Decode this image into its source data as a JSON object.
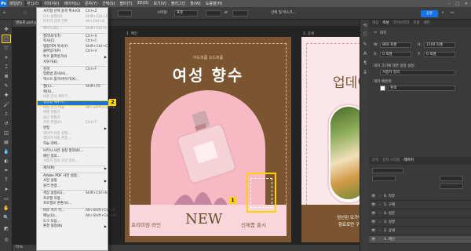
{
  "app": {
    "logo": "Ps",
    "menus": [
      "파일(F)",
      "편집(E)",
      "이미지(I)",
      "레이어(L)",
      "문자(Y)",
      "선택(S)",
      "필터(T)",
      "3D(D)",
      "보기(V)",
      "플러그인",
      "창(W)",
      "도움말(H)"
    ],
    "active_menu_index": 1
  },
  "options_bar": {
    "tolerance_label": "",
    "style_label": "스타일:",
    "style_value": "표준",
    "select_subject": "선택 및 마스크...",
    "share_label": "공유"
  },
  "doc_tab": {
    "title": "댄들로.psd @ 66.7..."
  },
  "canvas": {
    "artboard1_label": "1. 메인",
    "artboard2_label": "2. 상세",
    "artboard1": {
      "subtitle": "아도피룸 오드퍼퓸",
      "title": "여성 향수",
      "bottom_left": "프리미엄 라인",
      "bottom_center": "NEW",
      "bottom_right": "신제품 출시"
    },
    "artboard2": {
      "title": "업데이",
      "line1": "엄선된 오가닉",
      "line2": "향료로만 구성"
    },
    "badge_selection": "1"
  },
  "status_bar": {
    "zoom": "75%"
  },
  "edit_menu": {
    "badge_fill": "2",
    "items": [
      {
        "label": "사각형 선택 윤곽 취소(O)",
        "shortcut": "Ctrl+Z",
        "disabled": false
      },
      {
        "label": "다시 실행(O)",
        "shortcut": "Shift+Ctrl+Z",
        "disabled": true
      },
      {
        "label": "마지막 상태 전환",
        "shortcut": "Alt+Ctrl+Z",
        "disabled": true
      },
      {
        "sep": true
      },
      {
        "label": "페이드(D)...",
        "shortcut": "Shift+Ctrl+F",
        "disabled": true
      },
      {
        "sep": true
      },
      {
        "label": "잘라내기(T)",
        "shortcut": "Ctrl+X",
        "disabled": false
      },
      {
        "label": "복사(C)",
        "shortcut": "Ctrl+C",
        "disabled": false
      },
      {
        "label": "병합하여 복사(Y)",
        "shortcut": "Shift+Ctrl+C",
        "disabled": false
      },
      {
        "label": "붙여넣기(P)",
        "shortcut": "Ctrl+V",
        "disabled": false
      },
      {
        "label": "특수 붙여넣기(I)",
        "shortcut": "",
        "disabled": false,
        "submenu": true
      },
      {
        "label": "지우기(E)",
        "shortcut": "",
        "disabled": false
      },
      {
        "sep": true
      },
      {
        "label": "검색",
        "shortcut": "Ctrl+F",
        "disabled": false
      },
      {
        "label": "맞춤법 검사(H)...",
        "shortcut": "",
        "disabled": false
      },
      {
        "label": "텍스트 찾기/바꾸기(X)...",
        "shortcut": "",
        "disabled": false
      },
      {
        "sep": true
      },
      {
        "label": "칠(L)...",
        "shortcut": "Shift+F5",
        "disabled": false
      },
      {
        "label": "획(S)...",
        "shortcut": "",
        "disabled": false
      },
      {
        "label": "내용 인식 채우기...",
        "shortcut": "",
        "disabled": true
      },
      {
        "label": "생성형 채우기...",
        "shortcut": "",
        "disabled": false,
        "highlighted": true
      },
      {
        "label": "내용 인식 비율",
        "shortcut": "Alt+Shift+Ctrl+C",
        "disabled": true
      },
      {
        "label": "퍼펫 뒤틀기",
        "shortcut": "",
        "disabled": true
      },
      {
        "label": "원근 뒤틀기",
        "shortcut": "",
        "disabled": true
      },
      {
        "label": "자유 변형(F)",
        "shortcut": "Ctrl+T",
        "disabled": true
      },
      {
        "label": "변형",
        "shortcut": "",
        "disabled": false,
        "submenu": true
      },
      {
        "label": "레이어 자동 정렬...",
        "shortcut": "",
        "disabled": true
      },
      {
        "label": "레이어 자동 혼합...",
        "shortcut": "",
        "disabled": true
      },
      {
        "label": "하늘 대체...",
        "shortcut": "",
        "disabled": false
      },
      {
        "sep": true
      },
      {
        "label": "브러시 사전 설정 정의(B)...",
        "shortcut": "",
        "disabled": false
      },
      {
        "label": "패턴 정의...",
        "shortcut": "",
        "disabled": false
      },
      {
        "label": "사용자 정의 모양 정의...",
        "shortcut": "",
        "disabled": true
      },
      {
        "sep": true
      },
      {
        "label": "제거(R)",
        "shortcut": "",
        "disabled": false,
        "submenu": true
      },
      {
        "sep": true
      },
      {
        "label": "Adobe PDF 사전 설정...",
        "shortcut": "",
        "disabled": false
      },
      {
        "label": "사전 설정",
        "shortcut": "",
        "disabled": false,
        "submenu": true
      },
      {
        "label": "원격 연결...",
        "shortcut": "",
        "disabled": false
      },
      {
        "sep": true
      },
      {
        "label": "색상 설정(G)...",
        "shortcut": "Shift+Ctrl+K",
        "disabled": false
      },
      {
        "label": "프로필 지정...",
        "shortcut": "",
        "disabled": false
      },
      {
        "label": "프로필로 변환(V)...",
        "shortcut": "",
        "disabled": false
      },
      {
        "sep": true
      },
      {
        "label": "바로 가기 키...",
        "shortcut": "Alt+Shift+Ctrl+K",
        "disabled": false
      },
      {
        "label": "메뉴(U)...",
        "shortcut": "Alt+Shift+Ctrl+M",
        "disabled": false
      },
      {
        "label": "도구 모음...",
        "shortcut": "",
        "disabled": false
      },
      {
        "label": "환경 설정(N)",
        "shortcut": "",
        "disabled": false,
        "submenu": true
      }
    ]
  },
  "right_panel": {
    "top_tabs": [
      "색상",
      "속성",
      "라이브러리",
      "조정",
      "패턴"
    ],
    "active_top_tab": 1,
    "section_label": "대지",
    "width_label": "W:",
    "width_value": "860 픽셀",
    "height_label": "H:",
    "height_value": "1100 픽셀",
    "x_label": "X:",
    "x_value": "0 픽셀",
    "y_label": "Y:",
    "y_value": "0 픽셀",
    "preset_label": "대지 크기에 대한 설정 설정:",
    "preset_value": "사용자 정의",
    "bg_label": "대지 배경색:",
    "bg_value": "흰색",
    "layer_tabs": [
      "문자",
      "문자 스타일",
      "레이어"
    ],
    "active_layer_tab": 2,
    "layers": [
      {
        "name": "6. 리뷰",
        "selected": false
      },
      {
        "name": "5. 구매",
        "selected": false
      },
      {
        "name": "4. 성분",
        "selected": false
      },
      {
        "name": "3. 설명",
        "selected": false
      },
      {
        "name": "2. 상세",
        "selected": false
      },
      {
        "name": "1. 메인",
        "selected": true
      }
    ]
  },
  "colors": {
    "accent": "#1473e6",
    "highlight": "#ffd400",
    "brown": "#7a5530",
    "pink": "#f7b9c3"
  }
}
